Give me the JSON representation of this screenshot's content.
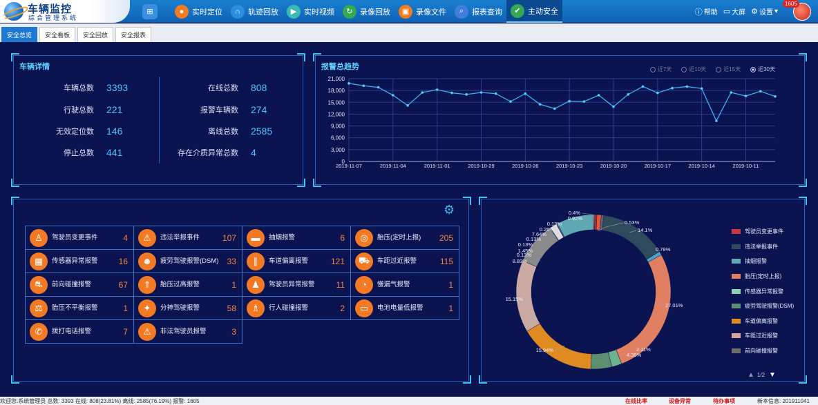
{
  "app": {
    "title": "车辆监控",
    "subtitle": "综合管理系统"
  },
  "nav": {
    "items": [
      {
        "label": "实时定位",
        "icon": "location-icon",
        "color": "#f47b20"
      },
      {
        "label": "轨迹回放",
        "icon": "track-icon",
        "color": "#2a8de0"
      },
      {
        "label": "实时视频",
        "icon": "play-icon",
        "color": "#3bbbb4"
      },
      {
        "label": "录像回放",
        "icon": "replay-icon",
        "color": "#34a853"
      },
      {
        "label": "录像文件",
        "icon": "video-file-icon",
        "color": "#f47b20"
      },
      {
        "label": "报表查询",
        "icon": "search-icon",
        "color": "#3f7fe0"
      },
      {
        "label": "主动安全",
        "icon": "shield-check-icon",
        "color": "#34a853"
      }
    ],
    "help": "帮助",
    "bigscreen": "大屏",
    "settings": "设置",
    "alert_count": "1605"
  },
  "tabs": [
    "安全总览",
    "安全看板",
    "安全回放",
    "安全报表"
  ],
  "vehicle": {
    "title": "车辆详情",
    "left": [
      {
        "label": "车辆总数",
        "value": "3393"
      },
      {
        "label": "行驶总数",
        "value": "221"
      },
      {
        "label": "无效定位数",
        "value": "146"
      },
      {
        "label": "停止总数",
        "value": "441"
      }
    ],
    "right": [
      {
        "label": "在线总数",
        "value": "808"
      },
      {
        "label": "报警车辆数",
        "value": "274"
      },
      {
        "label": "离线总数",
        "value": "2585"
      },
      {
        "label": "存在介质异常总数",
        "value": "4"
      }
    ]
  },
  "trend": {
    "title": "报警总趋势",
    "options": [
      "近7天",
      "近10天",
      "近15天",
      "近30天"
    ],
    "selected": 3
  },
  "chart_data": [
    {
      "type": "line",
      "title": "报警总趋势",
      "x": [
        "2019-11-07",
        "2019-11-06",
        "2019-11-05",
        "2019-11-04",
        "2019-11-03",
        "2019-11-02",
        "2019-11-01",
        "2019-10-31",
        "2019-10-30",
        "2019-10-29",
        "2019-10-28",
        "2019-10-27",
        "2019-10-26",
        "2019-10-25",
        "2019-10-24",
        "2019-10-23",
        "2019-10-22",
        "2019-10-21",
        "2019-10-20",
        "2019-10-19",
        "2019-10-18",
        "2019-10-17",
        "2019-10-16",
        "2019-10-15",
        "2019-10-14",
        "2019-10-13",
        "2019-10-12",
        "2019-10-11",
        "2019-10-10"
      ],
      "x_tick_labels": [
        "2019-11-07",
        "2019-11-04",
        "2019-11-01",
        "2019-10-29",
        "2019-10-26",
        "2019-10-23",
        "2019-10-20",
        "2019-10-17",
        "2019-10-14",
        "2019-10-11"
      ],
      "values": [
        19800,
        19200,
        18800,
        16800,
        14200,
        17500,
        18200,
        17400,
        17000,
        17500,
        17200,
        15200,
        17200,
        14500,
        13400,
        15300,
        15200,
        16800,
        13900,
        17000,
        19000,
        17400,
        18600,
        19000,
        18500,
        10300,
        17500,
        16600,
        17800,
        16500
      ],
      "yticks": [
        "0",
        "3,000",
        "6,000",
        "9,000",
        "12,000",
        "15,000",
        "18,000",
        "21,000"
      ],
      "ylim": [
        0,
        21000
      ],
      "grid": true
    },
    {
      "type": "pie",
      "variant": "donut",
      "labels": [
        "0.4%",
        "0.92%",
        "0.53%",
        "14.1%",
        "0.79%",
        "27.01%",
        "2.11%",
        "4.35%",
        "15.94%",
        "15.15%",
        "8.83%",
        "0.13%",
        "1.45%",
        "0.13%",
        "0.13%",
        "7.64%",
        "0.26%",
        "0.13%"
      ],
      "values": [
        0.4,
        0.92,
        0.53,
        14.1,
        0.79,
        27.01,
        2.11,
        4.35,
        15.94,
        15.15,
        8.83,
        0.13,
        1.45,
        0.13,
        0.13,
        7.64,
        0.26,
        0.13
      ],
      "colors": [
        "#c0392b",
        "#e6553a",
        "#5a6578",
        "#2f4a5c",
        "#4aa3c8",
        "#e07f62",
        "#6fb38e",
        "#5c8f70",
        "#e08b21",
        "#c9a9a2",
        "#8a8a8a",
        "#b0b8c4",
        "#dddddd",
        "#888fa0",
        "#c5ccd6",
        "#5fa9b4",
        "#d08a7a",
        "#9fb6c8"
      ],
      "legend_position": "right",
      "legend": [
        {
          "label": "驾驶员变更事件",
          "color": "#c8383c"
        },
        {
          "label": "违法举报事件",
          "color": "#2f4a5c"
        },
        {
          "label": "抽烟报警",
          "color": "#5fa9b4"
        },
        {
          "label": "胎压(定时上报)",
          "color": "#e07f62"
        },
        {
          "label": "传感器异常报警",
          "color": "#8fd1b5"
        },
        {
          "label": "疲劳驾驶报警(DSM)",
          "color": "#5c8f70"
        },
        {
          "label": "车道偏离报警",
          "color": "#e08b21"
        },
        {
          "label": "车距过近报警",
          "color": "#d8a59c"
        },
        {
          "label": "前向碰撞报警",
          "color": "#6c6c6c"
        }
      ],
      "page": "1/2"
    }
  ],
  "alarms": [
    {
      "label": "驾驶员变更事件",
      "value": "4",
      "icon": "driver-change-icon"
    },
    {
      "label": "违法举报事件",
      "value": "107",
      "icon": "siren-icon"
    },
    {
      "label": "抽烟报警",
      "value": "6",
      "icon": "cigarette-icon"
    },
    {
      "label": "胎压(定时上报)",
      "value": "205",
      "icon": "tire-clock-icon"
    },
    {
      "label": "传感器异常报警",
      "value": "16",
      "icon": "sensor-icon"
    },
    {
      "label": "疲劳驾驶报警(DSM)",
      "value": "33",
      "icon": "fatigue-icon"
    },
    {
      "label": "车道偏离报警",
      "value": "121",
      "icon": "lane-icon"
    },
    {
      "label": "车距过近报警",
      "value": "115",
      "icon": "car-distance-icon"
    },
    {
      "label": "前向碰撞报警",
      "value": "67",
      "icon": "collision-icon"
    },
    {
      "label": "胎压过高报警",
      "value": "1",
      "icon": "tire-high-icon"
    },
    {
      "label": "驾驶员异常报警",
      "value": "11",
      "icon": "driver-abnormal-icon"
    },
    {
      "label": "慢漏气报警",
      "value": "1",
      "icon": "slow-leak-icon"
    },
    {
      "label": "胎压不平衡报警",
      "value": "1",
      "icon": "tire-unbalance-icon"
    },
    {
      "label": "分神驾驶报警",
      "value": "58",
      "icon": "distraction-icon"
    },
    {
      "label": "行人碰撞报警",
      "value": "2",
      "icon": "pedestrian-icon"
    },
    {
      "label": "电池电量低报警",
      "value": "1",
      "icon": "battery-icon"
    },
    {
      "label": "拨打电话报警",
      "value": "7",
      "icon": "phone-icon"
    },
    {
      "label": "非法驾驶员报警",
      "value": "3",
      "icon": "siren-icon"
    }
  ],
  "status": {
    "text": "欢迎您:系统管理员 总数: 3393 在线: 808(23.81%) 离线: 2585(76.19%) 报警: 1605",
    "links": [
      "在线比率",
      "设备异常",
      "待办事项"
    ],
    "version": "新本信息: 201911041"
  }
}
